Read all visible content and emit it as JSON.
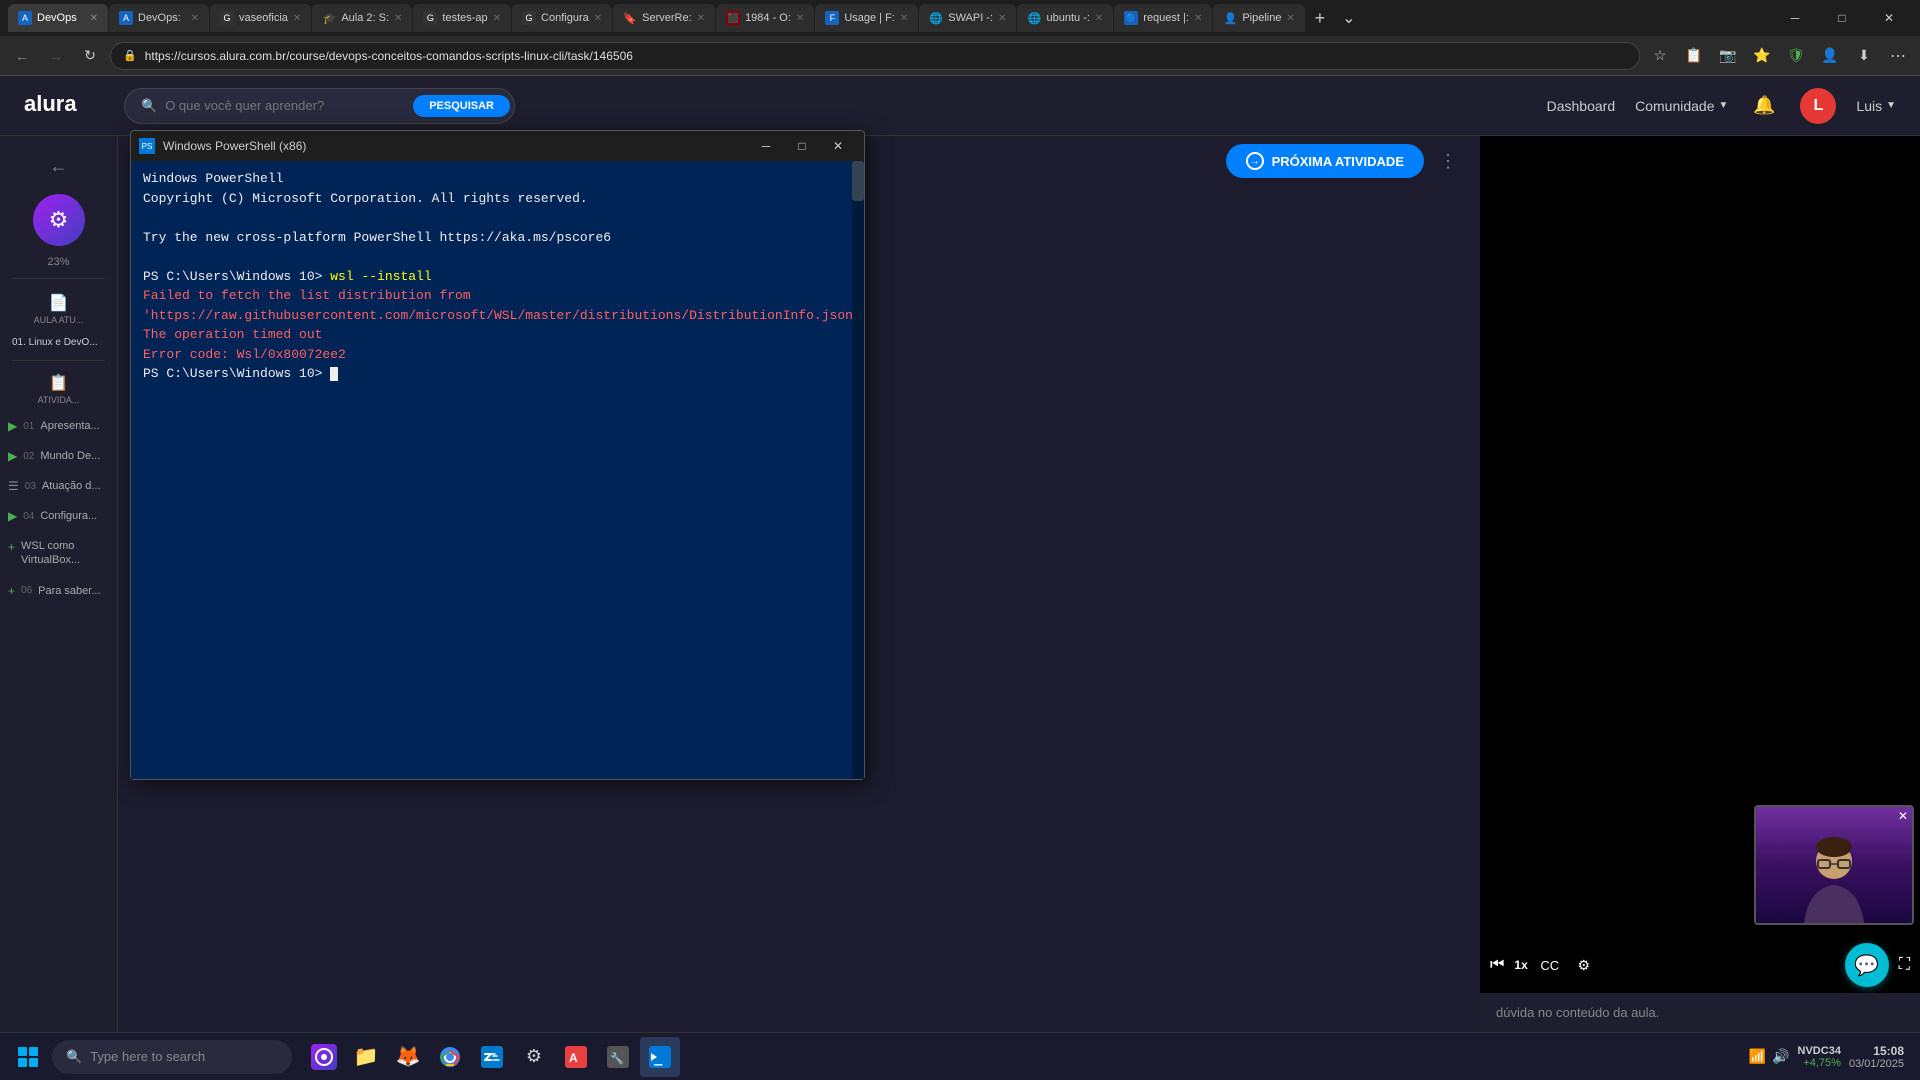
{
  "browser": {
    "tabs": [
      {
        "id": 1,
        "label": "DevOps",
        "active": true,
        "color": "#4a9eff",
        "icon": "A"
      },
      {
        "id": 2,
        "label": "DevOps:",
        "active": false,
        "color": "#4a9eff",
        "icon": "A"
      },
      {
        "id": 3,
        "label": "vaseoficia",
        "active": false,
        "color": "#333",
        "icon": "G"
      },
      {
        "id": 4,
        "label": "Aula 2: S:",
        "active": false,
        "color": "#333",
        "icon": "🎓"
      },
      {
        "id": 5,
        "label": "testes-ap",
        "active": false,
        "color": "#333",
        "icon": "G"
      },
      {
        "id": 6,
        "label": "Configura",
        "active": false,
        "color": "#333",
        "icon": "G"
      },
      {
        "id": 7,
        "label": "ServerRe:",
        "active": false,
        "color": "#4a9eff",
        "icon": "🔖"
      },
      {
        "id": 8,
        "label": "1984 - O:",
        "active": false,
        "color": "#c00",
        "icon": "⬛"
      },
      {
        "id": 9,
        "label": "Usage | F:",
        "active": false,
        "color": "#4a9eff",
        "icon": "F"
      },
      {
        "id": 10,
        "label": "SWAPI -:",
        "active": false,
        "color": "#333",
        "icon": "🌐"
      },
      {
        "id": 11,
        "label": "ubuntu -:",
        "active": false,
        "color": "#333",
        "icon": "🌐"
      },
      {
        "id": 12,
        "label": "request |:",
        "active": false,
        "color": "#4a9eff",
        "icon": "🔵"
      },
      {
        "id": 13,
        "label": "Pipeline",
        "active": false,
        "color": "#333",
        "icon": "👤"
      }
    ],
    "url": "https://cursos.alura.com.br/course/devops-conceitos-comandos-scripts-linux-cli/task/146506"
  },
  "alura_header": {
    "logo": "alura",
    "search_placeholder": "O que você quer aprender?",
    "search_btn": "PESQUISAR",
    "dashboard_label": "Dashboard",
    "comunidade_label": "Comunidade",
    "user_initial": "L",
    "user_name": "Luis",
    "next_activity_btn": "PRÓXIMA ATIVIDADE"
  },
  "sidebar": {
    "back_icon": "←",
    "progress": "23%",
    "aula_atual_label": "AULA ATU...",
    "section_label": "01. Linux e DevO...",
    "atividades_label": "ATIVIDA...",
    "lessons": [
      {
        "num": "01",
        "label": "Apresenta...",
        "icon": "play",
        "type": "video"
      },
      {
        "num": "02",
        "label": "Mundo De...",
        "icon": "play",
        "type": "video"
      },
      {
        "num": "03",
        "label": "Atuação d...",
        "icon": "list",
        "type": "list"
      },
      {
        "num": "04",
        "label": "Configura...",
        "icon": "play",
        "type": "video"
      },
      {
        "num": "",
        "label": "WSL como VirtualBox...",
        "icon": "plus",
        "type": "bonus"
      },
      {
        "num": "06",
        "label": "Para saber...",
        "icon": "plus",
        "type": "extra"
      }
    ]
  },
  "powershell": {
    "title": "Windows PowerShell (x86)",
    "lines": [
      {
        "text": "Windows PowerShell",
        "type": "normal"
      },
      {
        "text": "Copyright (C) Microsoft Corporation. All rights reserved.",
        "type": "normal"
      },
      {
        "text": "",
        "type": "normal"
      },
      {
        "text": "Try the new cross-platform PowerShell https://aka.ms/pscore6",
        "type": "normal"
      },
      {
        "text": "",
        "type": "normal"
      },
      {
        "text": "PS C:\\Users\\Windows 10> ",
        "type": "prompt",
        "cmd": "wsl --install"
      },
      {
        "text": "Failed to fetch the list distribution from 'https://raw.githubusercontent.com/microsoft/WSL/master/distributions/DistributionInfo.json'. The operation timed out",
        "type": "error"
      },
      {
        "text": "Error code: Wsl/0x80072ee2",
        "type": "error"
      },
      {
        "text": "PS C:\\Users\\Windows 10> ",
        "type": "prompt",
        "cursor": true
      }
    ],
    "min_btn": "─",
    "max_btn": "□",
    "close_btn": "✕"
  },
  "video": {
    "speed": "1x",
    "has_pip": true,
    "doubt_text": "dúvida no conteúdo da aula."
  },
  "taskbar": {
    "search_placeholder": "Type here to search",
    "apps": [
      {
        "name": "Firefox",
        "icon": "🦊",
        "color": "#ff6600"
      },
      {
        "name": "File Explorer",
        "icon": "📁",
        "color": "#ffcc00"
      },
      {
        "name": "Firefox",
        "icon": "🦊",
        "color": "#ff6600"
      },
      {
        "name": "Chrome",
        "icon": "⊕",
        "color": "#4285f4"
      },
      {
        "name": "VS Code",
        "icon": "◈",
        "color": "#007acc"
      },
      {
        "name": "Terminal",
        "icon": "⬛",
        "color": "#333"
      },
      {
        "name": "App6",
        "icon": "◉",
        "color": "#ff4444"
      },
      {
        "name": "App7",
        "icon": "◈",
        "color": "#888"
      },
      {
        "name": "PowerShell",
        "icon": "▶",
        "color": "#0078d7"
      }
    ],
    "stock_name": "NVDC34",
    "stock_change": "+4,75%",
    "time": "15:08",
    "date": "03/01/2025"
  }
}
